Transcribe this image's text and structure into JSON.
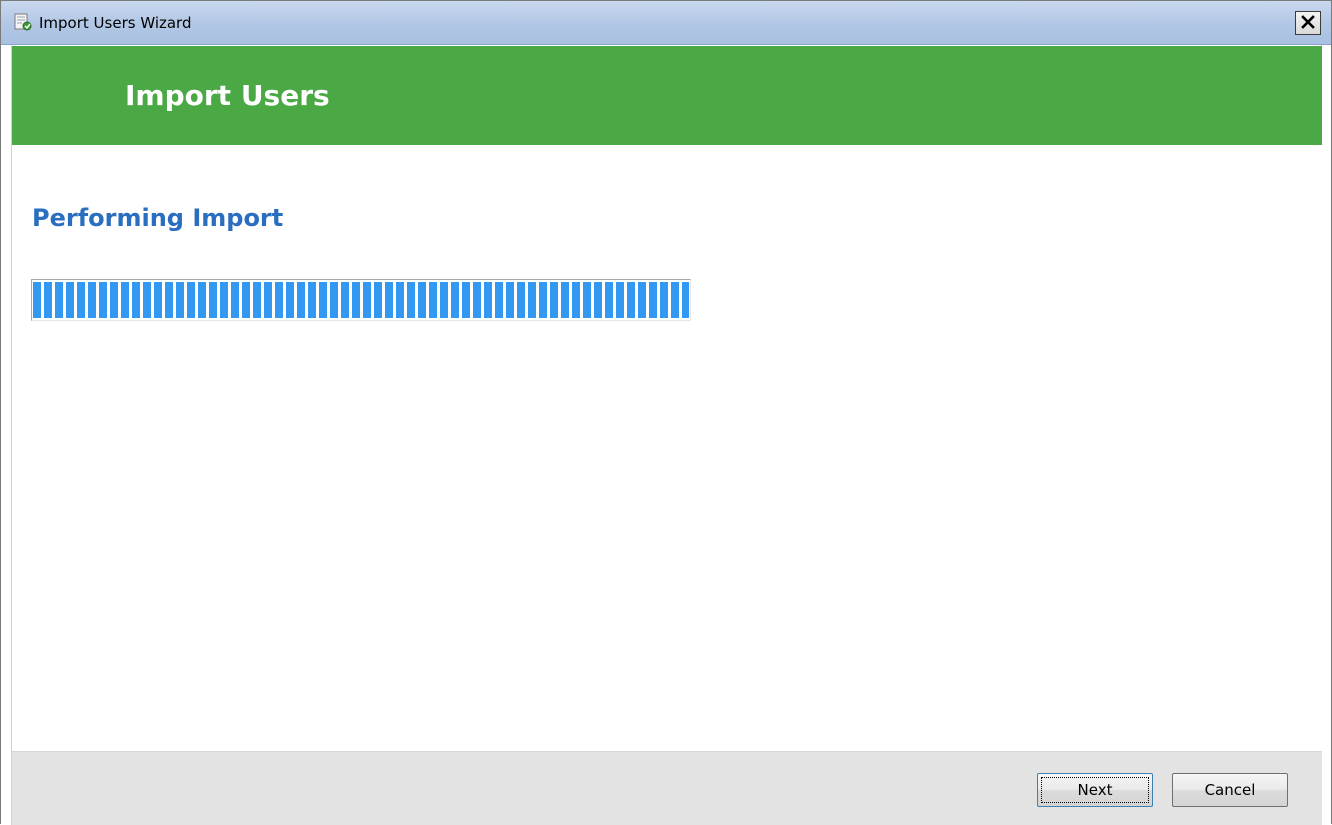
{
  "window": {
    "title": "Import Users Wizard"
  },
  "header": {
    "title": "Import Users",
    "background_color": "#4aa944"
  },
  "main": {
    "section_title": "Performing Import",
    "progress": {
      "fraction": 1.0,
      "fill_color": "#3398f2"
    }
  },
  "footer": {
    "next_label": "Next",
    "cancel_label": "Cancel"
  },
  "icons": {
    "app": "wizard-document-icon",
    "close": "close-icon"
  }
}
